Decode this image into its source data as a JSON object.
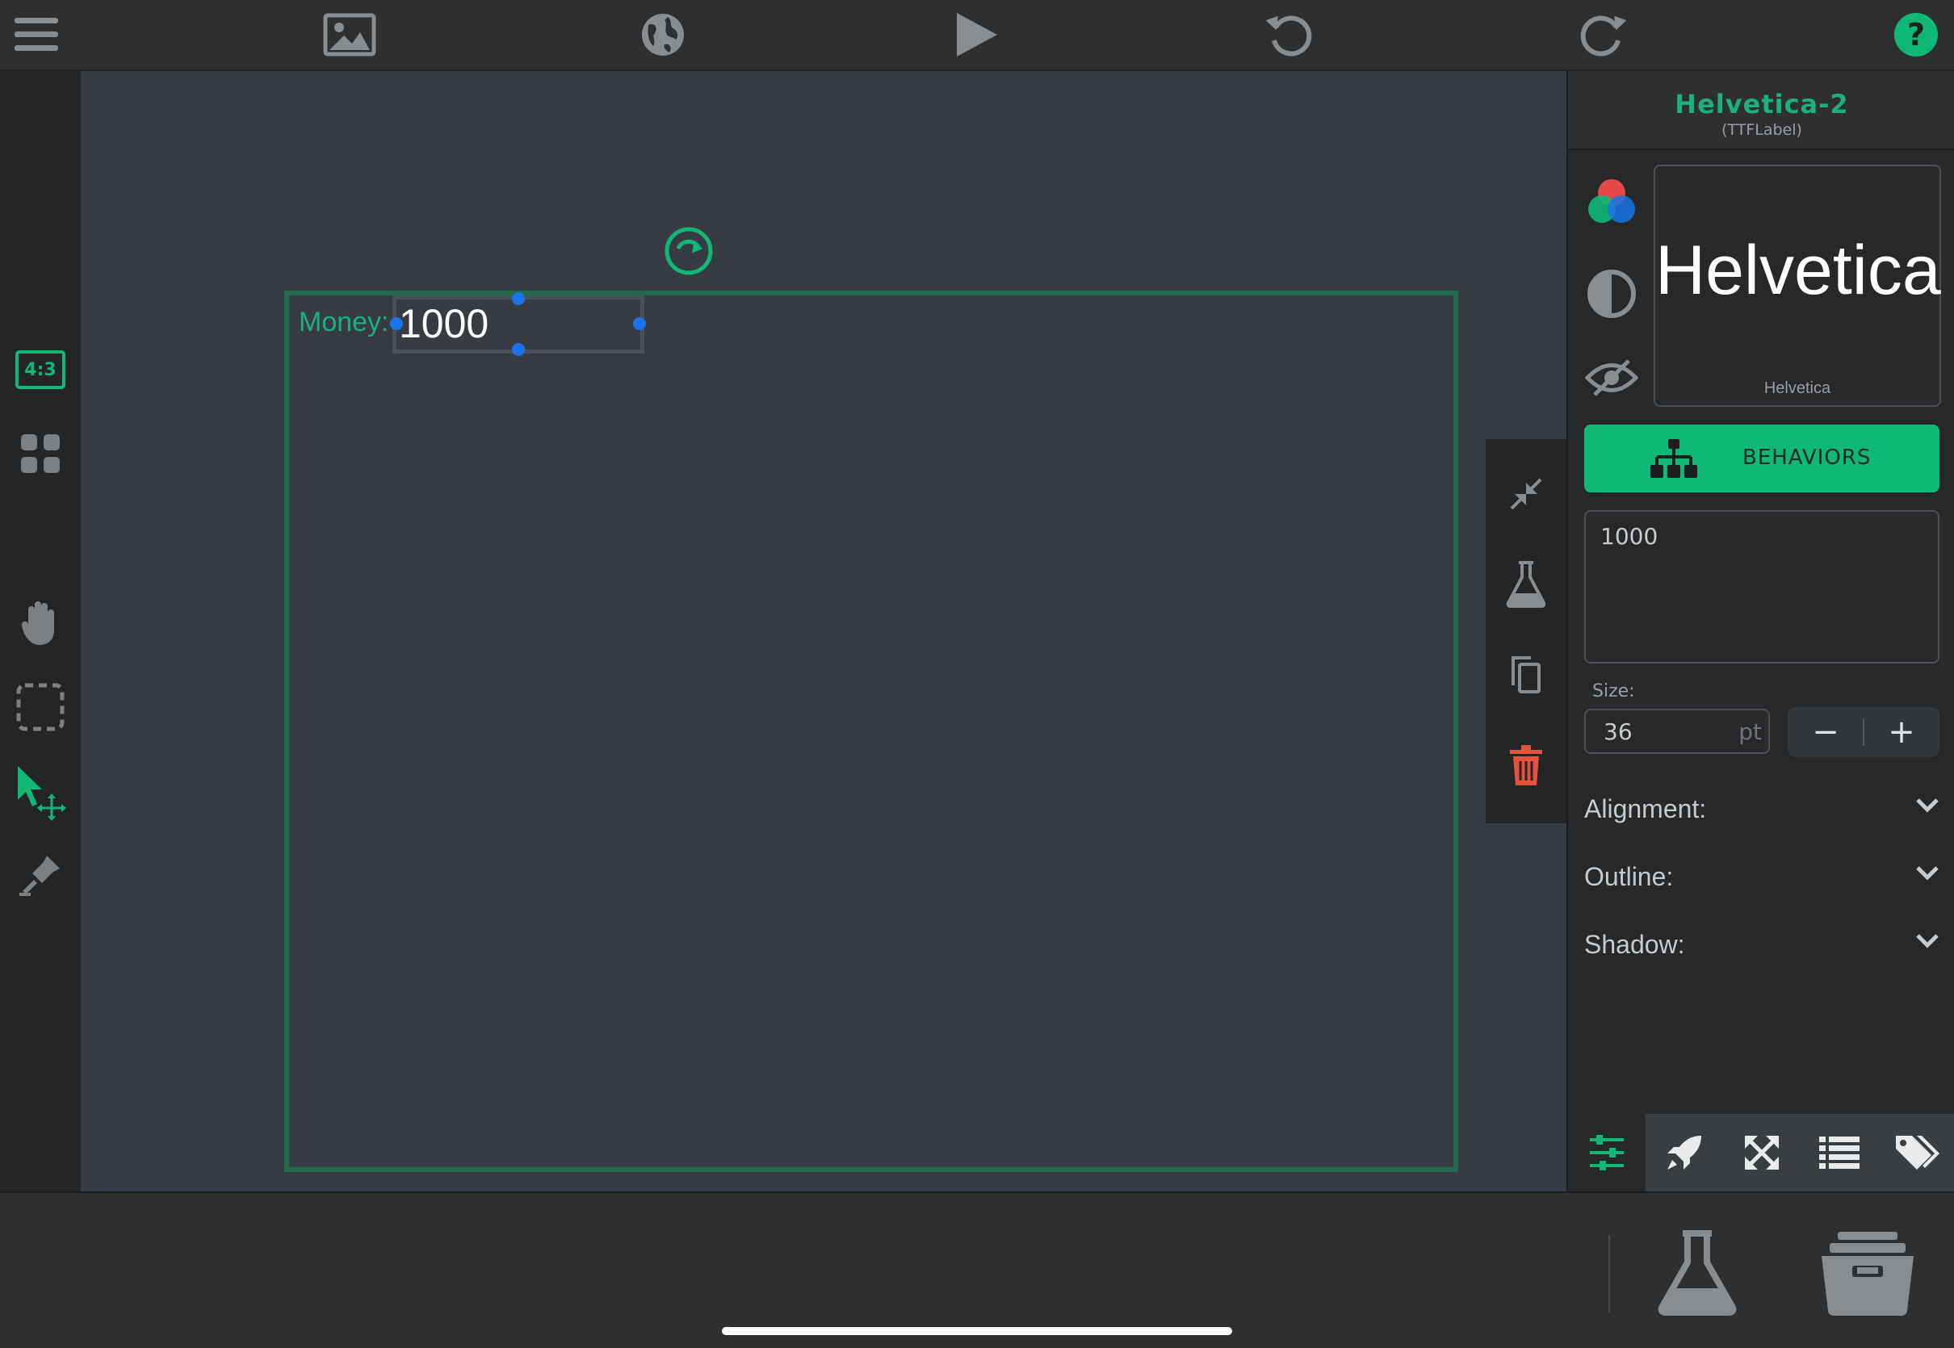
{
  "topbar": {
    "icons": [
      "menu-icon",
      "image-icon",
      "globe-icon",
      "play-icon",
      "undo-icon",
      "redo-icon",
      "help-icon"
    ]
  },
  "leftrail": {
    "aspect_label": "4:3",
    "tools": [
      "grid-icon",
      "hand-icon",
      "marquee-select-icon",
      "move-select-icon",
      "stamp-icon"
    ]
  },
  "canvas": {
    "money_label": "Money:",
    "money_value": "1000"
  },
  "floattools": [
    "collapse-icon",
    "flask-icon",
    "copy-icon",
    "trash-icon"
  ],
  "panel": {
    "title": "Helvetica-2",
    "subtitle": "(TTFLabel)",
    "preview_text": "Helvetica",
    "preview_font_name": "Helvetica",
    "behaviors_label": "BEHAVIORS",
    "text_value": "1000",
    "size_label": "Size:",
    "size_value": "36",
    "size_unit": "pt",
    "minus": "−",
    "plus": "+",
    "rows": [
      {
        "label": "Alignment:"
      },
      {
        "label": "Outline:"
      },
      {
        "label": "Shadow:"
      }
    ],
    "tabs": [
      "sliders-icon",
      "rocket-icon",
      "expand-icon",
      "list-icon",
      "tags-icon"
    ]
  },
  "bottombar": {
    "icons": [
      "flask-icon",
      "archive-icon"
    ]
  },
  "colors": {
    "accent": "#1ab27a",
    "behaviors_bg": "#10b878",
    "handle": "#1a73e8",
    "danger": "#e5533d",
    "canvas_bg": "#373c44"
  }
}
